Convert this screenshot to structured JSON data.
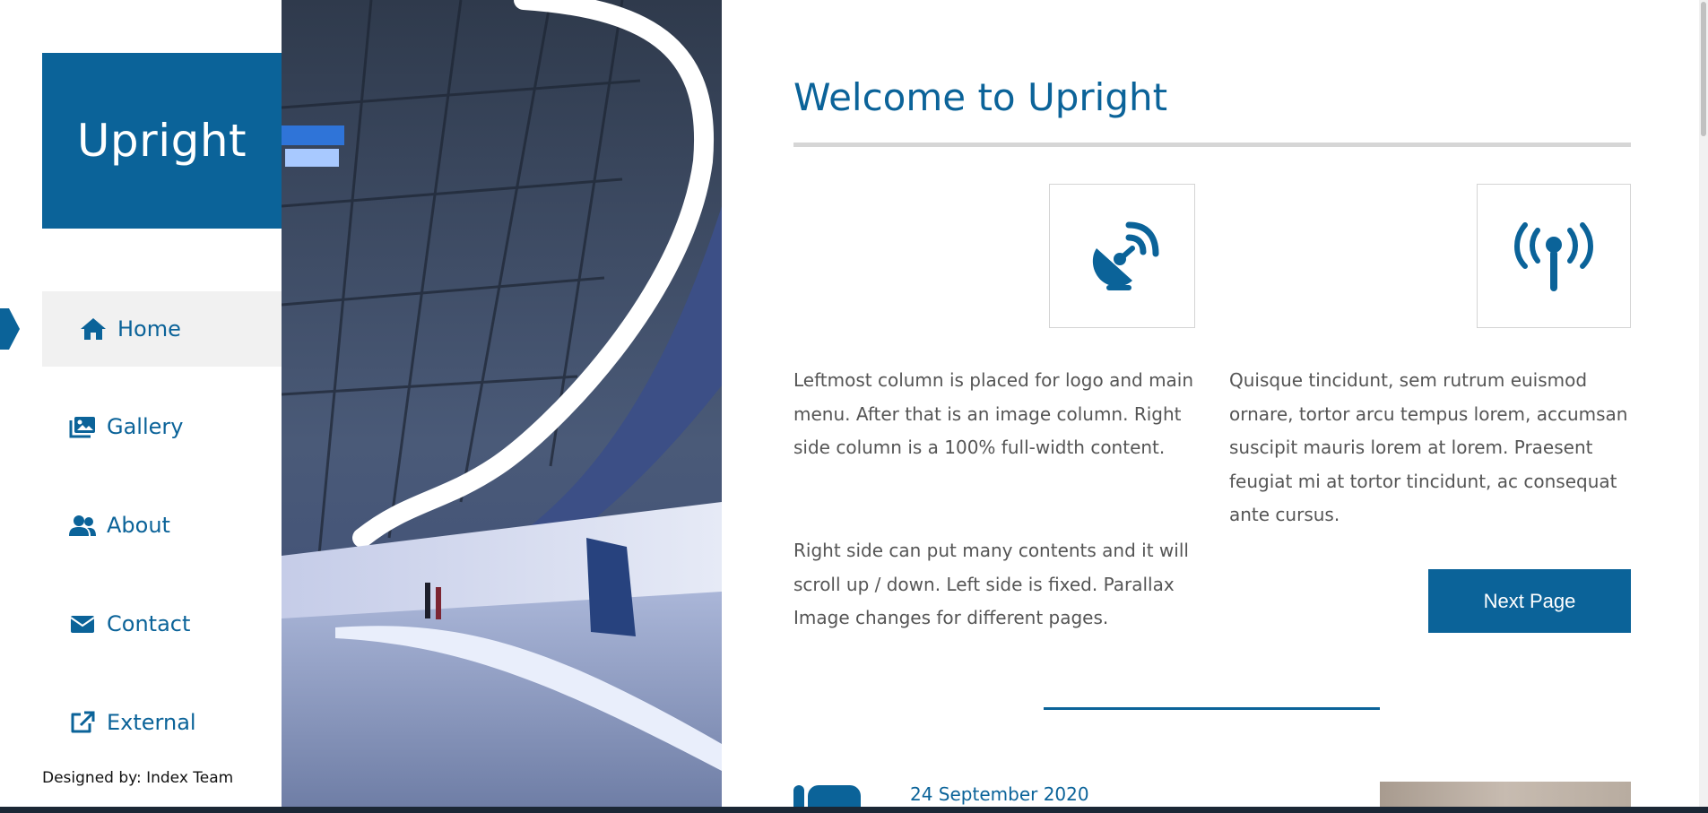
{
  "brand": {
    "logo": "Upright"
  },
  "nav": {
    "items": [
      {
        "label": "Home",
        "icon": "home-icon",
        "active": true
      },
      {
        "label": "Gallery",
        "icon": "images-icon",
        "active": false
      },
      {
        "label": "About",
        "icon": "users-icon",
        "active": false
      },
      {
        "label": "Contact",
        "icon": "envelope-icon",
        "active": false
      },
      {
        "label": "External",
        "icon": "external-link-icon",
        "active": false
      }
    ]
  },
  "footer": {
    "credit": "Designed by: Index Team"
  },
  "main": {
    "title": "Welcome to Upright",
    "feature_icons": [
      "satellite-dish-icon",
      "broadcast-tower-icon"
    ],
    "left_paragraph_1": "Leftmost column is placed for logo and main menu. After that is an image column. Right side column is a 100% full-width content.",
    "left_paragraph_2": "Right side can put many contents and it will scroll up / down. Left side is fixed. Parallax Image changes for different pages.",
    "right_paragraph": "Quisque tincidunt, sem rutrum euismod ornare, tortor arcu tempus lorem, accumsan suscipit mauris lorem at lorem. Praesent feugiat mi at tortor tincidunt, ac consequat ante cursus.",
    "next_button": "Next Page",
    "post": {
      "date": "24 September 2020"
    }
  },
  "colors": {
    "brand": "#0b6399",
    "active_nav_bg": "#f1f1f1",
    "rule": "#d6d6d6"
  }
}
